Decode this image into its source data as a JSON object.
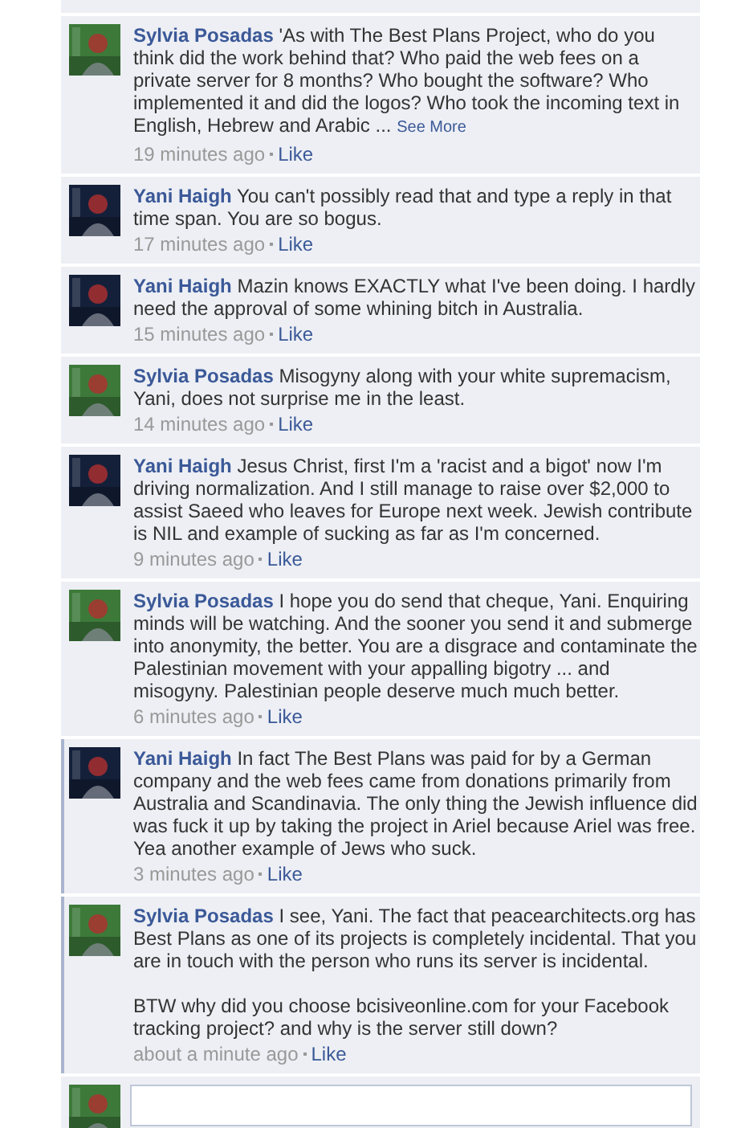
{
  "comments": [
    {
      "author": "Sylvia Posadas",
      "text": "'As with The Best Plans Project, who do you think did the work behind that? Who paid the web fees on a private server for 8 months? Who bought the software? Who implemented it and did the logos? Who took the incoming text in English, Hebrew and Arabic ...",
      "see_more": "See More",
      "time": "19 minutes ago",
      "like": "Like",
      "new": false,
      "avatar": {
        "color": "#3d7a3a"
      }
    },
    {
      "author": "Yani Haigh",
      "text": "You can't possibly read that and type a reply in that time span. You are so bogus.",
      "time": "17 minutes ago",
      "like": "Like",
      "new": false,
      "avatar": {
        "color": "#14203a"
      }
    },
    {
      "author": "Yani Haigh",
      "text": "Mazin knows EXACTLY what I've been doing. I hardly need the approval of some whining bitch in Australia.",
      "time": "15 minutes ago",
      "like": "Like",
      "new": false,
      "avatar": {
        "color": "#14203a"
      }
    },
    {
      "author": "Sylvia Posadas",
      "text": "Misogyny along with your white supremacism, Yani, does not surprise me in the least.",
      "time": "14 minutes ago",
      "like": "Like",
      "new": false,
      "avatar": {
        "color": "#3d7a3a"
      }
    },
    {
      "author": "Yani Haigh",
      "text": "Jesus Christ, first I'm a 'racist and a bigot' now I'm driving normalization. And I still manage to raise over $2,000 to assist Saeed who leaves for Europe next week. Jewish contribute is NIL and example of sucking as far as I'm concerned.",
      "time": "9 minutes ago",
      "like": "Like",
      "new": false,
      "avatar": {
        "color": "#14203a"
      }
    },
    {
      "author": "Sylvia Posadas",
      "text": "I hope you do send that cheque, Yani. Enquiring minds will be watching. And the sooner you send it and submerge into anonymity, the better. You are a disgrace and contaminate the Palestinian movement with your appalling bigotry ... and misogyny. Palestinian people deserve much much better.",
      "time": "6 minutes ago",
      "like": "Like",
      "new": false,
      "avatar": {
        "color": "#3d7a3a"
      }
    },
    {
      "author": "Yani Haigh",
      "text": "In fact The Best Plans was paid for by a German company and the web fees came from donations primarily from Australia and Scandinavia. The only thing the Jewish influence did was fuck it up by taking the project in Ariel because Ariel was free. Yea another example of Jews who suck.",
      "time": "3 minutes ago",
      "like": "Like",
      "new": true,
      "avatar": {
        "color": "#14203a"
      }
    },
    {
      "author": "Sylvia Posadas",
      "text": "I see, Yani. The fact that peacearchitects.org has Best Plans as one of its projects is completely incidental. That you are in touch with the person who runs its server is incidental.\n\nBTW why did you choose bcisiveonline.com for your Facebook tracking project? and why is the server still down?",
      "time": "about a minute ago",
      "like": "Like",
      "new": true,
      "avatar": {
        "color": "#3d7a3a"
      }
    }
  ],
  "composer": {
    "avatar": {
      "color": "#3d7a3a"
    }
  }
}
